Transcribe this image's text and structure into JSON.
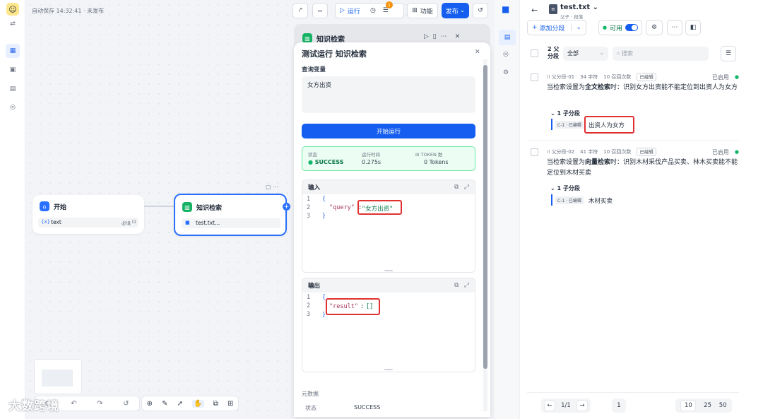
{
  "canvas": {
    "autosave": "自动保存 14:32:41 · 未发布",
    "toolbar": {
      "run_label": "运行",
      "badge_count": "1",
      "feature_label": "功能",
      "publish_label": "发布"
    },
    "start_node": {
      "title": "开始",
      "var_prefix": "{x}",
      "var_name": "text",
      "required": "必填"
    },
    "kb_node": {
      "title": "知识检索",
      "file": "test.txt..."
    },
    "panel_title": "知识检索",
    "watermark": "大数跨境"
  },
  "dialog": {
    "title": "测试运行 知识检索",
    "query_label": "查询变量",
    "query_value": "女方出资",
    "run_button": "开始运行",
    "status": {
      "status_label": "状态",
      "status_value": "SUCCESS",
      "time_label": "运行时间",
      "time_value": "0.275s",
      "token_label": "TOKEN 数",
      "token_value": "0 Tokens"
    },
    "input": {
      "title": "输入",
      "lines": [
        "1",
        "2",
        "3"
      ],
      "open_brace": "{",
      "key": "\"query\"",
      "colon": ":",
      "value": "\"女方出资\"",
      "close_brace": "}"
    },
    "output": {
      "title": "输出",
      "lines": [
        "1",
        "2",
        "3"
      ],
      "open_brace": "{",
      "key": "\"result\"",
      "colon": ":",
      "value": "[]",
      "close_brace": "}"
    },
    "meta_label": "元数据",
    "meta_status_label": "状态",
    "meta_status_value": "SUCCESS"
  },
  "right": {
    "file_name": "test.txt",
    "file_sub": "父子 · 段落",
    "add_segment": "添加分段",
    "available": "可用",
    "count_label_1": "2 父",
    "count_label_2": "分段",
    "filter_all": "全部",
    "search_placeholder": "搜索",
    "segments": [
      {
        "id": "父分段-01",
        "chars": "34 字符",
        "hits": "10 召回次数",
        "edited": "已编辑",
        "status": "已启用",
        "text_pre": "当检索设置为",
        "text_bold": "全文检索",
        "text_post": "时：识别女方出资能不能定位到出资人为女方",
        "child_count": "1 子分段",
        "child_tag": "C-1 · 已编辑",
        "child_text": "出资人为女方"
      },
      {
        "id": "父分段-02",
        "chars": "41 字符",
        "hits": "10 召回次数",
        "edited": "已编辑",
        "status": "已启用",
        "text_pre": "当检索设置为",
        "text_bold": "向量检索",
        "text_post": "时：识别木材采伐产品买卖、林木买卖能不能定位到木材买卖",
        "child_count": "1 子分段",
        "child_tag": "C-1 · 已编辑",
        "child_text": "木材买卖"
      }
    ],
    "pagination": {
      "page_info": "1/1",
      "current": "1",
      "sizes": [
        "10",
        "25",
        "50"
      ]
    }
  },
  "colors": {
    "accent": "#155eef",
    "success": "#12b76a",
    "highlight": "#e03131"
  }
}
